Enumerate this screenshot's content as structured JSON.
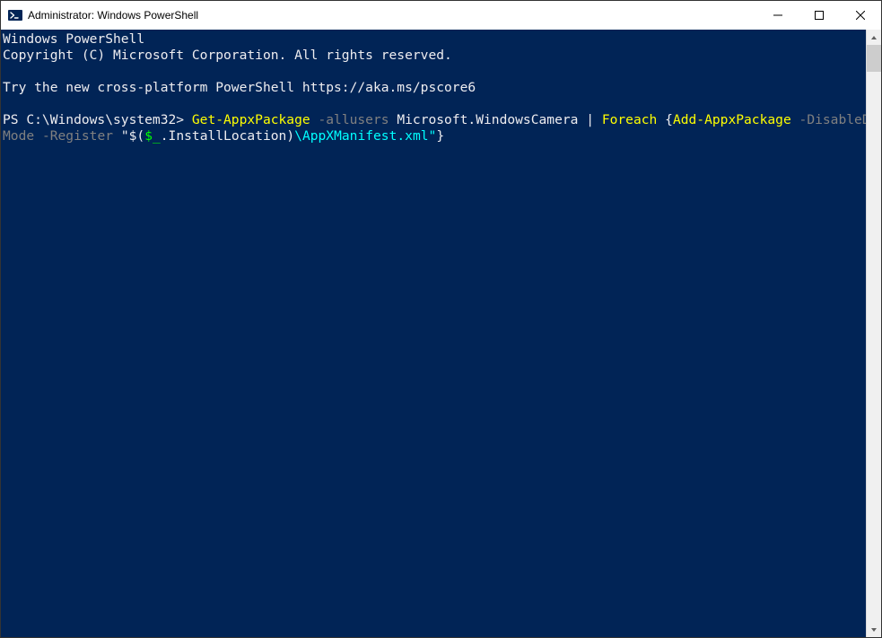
{
  "window": {
    "title": "Administrator: Windows PowerShell"
  },
  "terminal": {
    "line1": "Windows PowerShell",
    "line2": "Copyright (C) Microsoft Corporation. All rights reserved.",
    "line3": "",
    "line4": "Try the new cross-platform PowerShell https://aka.ms/pscore6",
    "line5": "",
    "prompt": "PS C:\\Windows\\system32> ",
    "cmd": {
      "seg1": "Get-AppxPackage",
      "sp1": " ",
      "seg2": "-allusers",
      "sp2": " ",
      "seg3": "Microsoft.WindowsCamera",
      "sp3": " ",
      "seg4": "|",
      "sp4": " ",
      "seg5": "Foreach",
      "sp5": " ",
      "seg6": "{",
      "seg7": "Add-AppxPackage",
      "sp6": " ",
      "seg8": "-DisableDevelopment",
      "seg9": "Mode",
      "sp7": " ",
      "seg10": "-Register",
      "sp8": " ",
      "seg11": "\"$(",
      "seg12": "$_",
      "seg13": ".InstallLocation",
      "seg14": ")",
      "seg15": "\\AppXManifest.xml\"",
      "seg16": "}"
    }
  }
}
